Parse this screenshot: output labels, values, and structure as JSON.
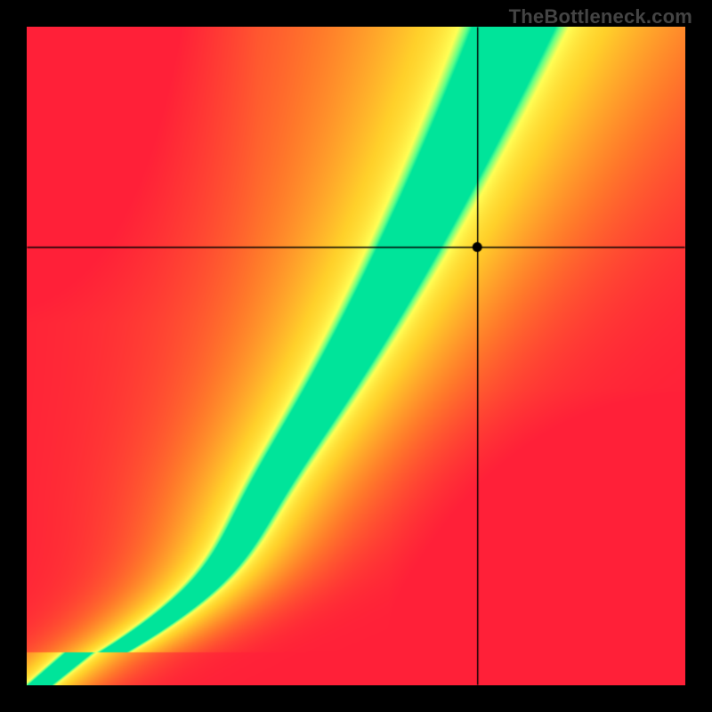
{
  "watermark": "TheBottleneck.com",
  "chart_data": {
    "type": "heatmap",
    "title": "",
    "xlabel": "",
    "ylabel": "",
    "xlim": [
      0,
      1
    ],
    "ylim": [
      0,
      1
    ],
    "crosshair": {
      "x": 0.685,
      "y": 0.665
    },
    "marker": {
      "x": 0.685,
      "y": 0.665
    },
    "ideal_curve_note": "green ridge along x≈f(y); away from ridge fades yellow→orange→red",
    "color_scale": [
      "#ff2038",
      "#ff7a2a",
      "#ffd02a",
      "#ffff55",
      "#5aff8a",
      "#00e49a"
    ],
    "ridge_samples_y_to_x": [
      [
        0.0,
        0.02
      ],
      [
        0.1,
        0.13
      ],
      [
        0.2,
        0.25
      ],
      [
        0.3,
        0.34
      ],
      [
        0.4,
        0.42
      ],
      [
        0.5,
        0.49
      ],
      [
        0.6,
        0.55
      ],
      [
        0.7,
        0.6
      ],
      [
        0.8,
        0.65
      ],
      [
        0.9,
        0.7
      ],
      [
        1.0,
        0.74
      ]
    ]
  },
  "canvas": {
    "size": 740,
    "border_px": 0
  }
}
